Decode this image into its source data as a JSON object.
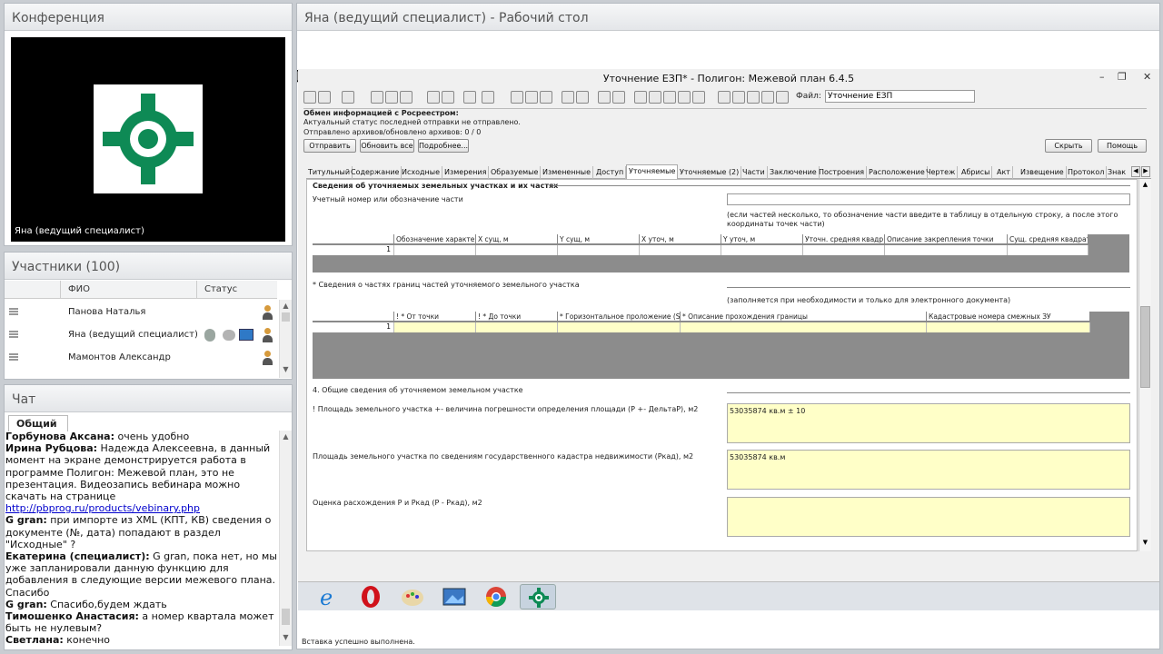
{
  "conference": {
    "title": "Конференция",
    "speaker": "Яна (ведущий специалист)"
  },
  "participants": {
    "title": "Участники (100)",
    "col_name": "ФИО",
    "col_status": "Статус",
    "rows": [
      "Панова Наталья",
      "Яна (ведущий специалист)",
      "Мамонтов Александр"
    ]
  },
  "chat": {
    "title": "Чат",
    "tab": "Общий",
    "messages": [
      {
        "author": "Горбунова Аксана:",
        "text": " очень удобно"
      },
      {
        "author": "Ирина Рубцова:",
        "text": " Надежда  Алексеевна, в данный момент на экране демонстрируется работа в программе Полигон: Межевой план, это не презентация. Видеозапись вебинара можно скачать на странице ",
        "link": "http://pbprog.ru/products/vebinary.php"
      },
      {
        "author": "G gran:",
        "text": " при импорте из XML (КПТ, КВ) сведения о документе (№, дата) попадают в раздел \"Исходные\" ?"
      },
      {
        "author": "Екатерина (специалист):",
        "text": " G gran, пока нет, но мы уже запланировали данную функцию для добавления в следующие версии межевого плана. Спасибо"
      },
      {
        "author": "G gran:",
        "text": " Спасибо,будем ждать"
      },
      {
        "author": "Тимошенко Анастасия:",
        "text": " а номер квартала может быть не нулевым?"
      },
      {
        "author": "Светлана:",
        "text": " конечно"
      }
    ]
  },
  "desktop": {
    "title": "Яна (ведущий специалист) - Рабочий стол"
  },
  "app": {
    "title": "Уточнение ЕЗП* - Полигон: Межевой план 6.4.5",
    "file_label": "Файл:",
    "file_value": "Уточнение ЕЗП",
    "exchange_title": "Обмен информацией с Росреестром:",
    "exchange_status": "Актуальный статус последней отправки не отправлено.",
    "exchange_archives": "Отправлено архивов/обновлено архивов: 0 / 0",
    "buttons": {
      "send": "Отправить",
      "refresh_all": "Обновить все",
      "more": "Подробнее...",
      "hide": "Скрыть",
      "help": "Помощь"
    },
    "tabs": [
      "Титульный",
      "Содержание",
      "Исходные",
      "Измерения",
      "Образуемые",
      "Измененные",
      "Доступ",
      "Уточняемые",
      "Уточняемые (2)",
      "Части",
      "Заключение",
      "Построения",
      "Расположение",
      "Чертеж",
      "Абрисы",
      "Акт",
      "Извещение",
      "Протокол",
      "Знак"
    ],
    "active_tab": "Уточняемые",
    "section1_title": "Сведения об уточняемых земельных участках и их частях",
    "part_label": "Учетный номер или обозначение части",
    "part_hint": "(если частей несколько, то обозначение части введите в таблицу в отдельную строку, а после этого координаты точек части)",
    "grid1_cols": [
      "Обозначение характер",
      "X сущ, м",
      "Y сущ, м",
      "X уточ, м",
      "Y уточ, м",
      "Уточн. средняя квадр",
      "Описание закрепления точки",
      "Сущ. средняя квадрат"
    ],
    "grid1_row": "1",
    "borders_label": "* Сведения о частях границ частей уточняемого земельного участка",
    "borders_hint": "(заполняется при необходимости и только для электронного документа)",
    "grid2_cols": [
      "! * От точки",
      "! * До точки",
      "* Горизонтальное проложение (S),",
      "* Описание прохождения границы",
      "Кадастровые номера смежных ЗУ"
    ],
    "grid2_row": "1",
    "section4_title": "4. Общие сведения об уточняемом земельном участке",
    "area_label": "! Площадь земельного участка +- величина погрешности определения площади (P +- ДельтаР), м2",
    "area_value": "53035874 кв.м ± 10",
    "gkn_label": "Площадь земельного участка по сведениям государственного кадастра недвижимости (Ркад), м2",
    "gkn_value": "53035874 кв.м",
    "diff_label": "Оценка расхождения Р и Ркад (Р - Ркад), м2",
    "diff_value": "",
    "status": "Вставка успешно выполнена."
  },
  "taskbar": [
    "ie-icon",
    "opera-icon",
    "paint-icon",
    "photos-icon",
    "chrome-icon",
    "polygon-icon"
  ]
}
